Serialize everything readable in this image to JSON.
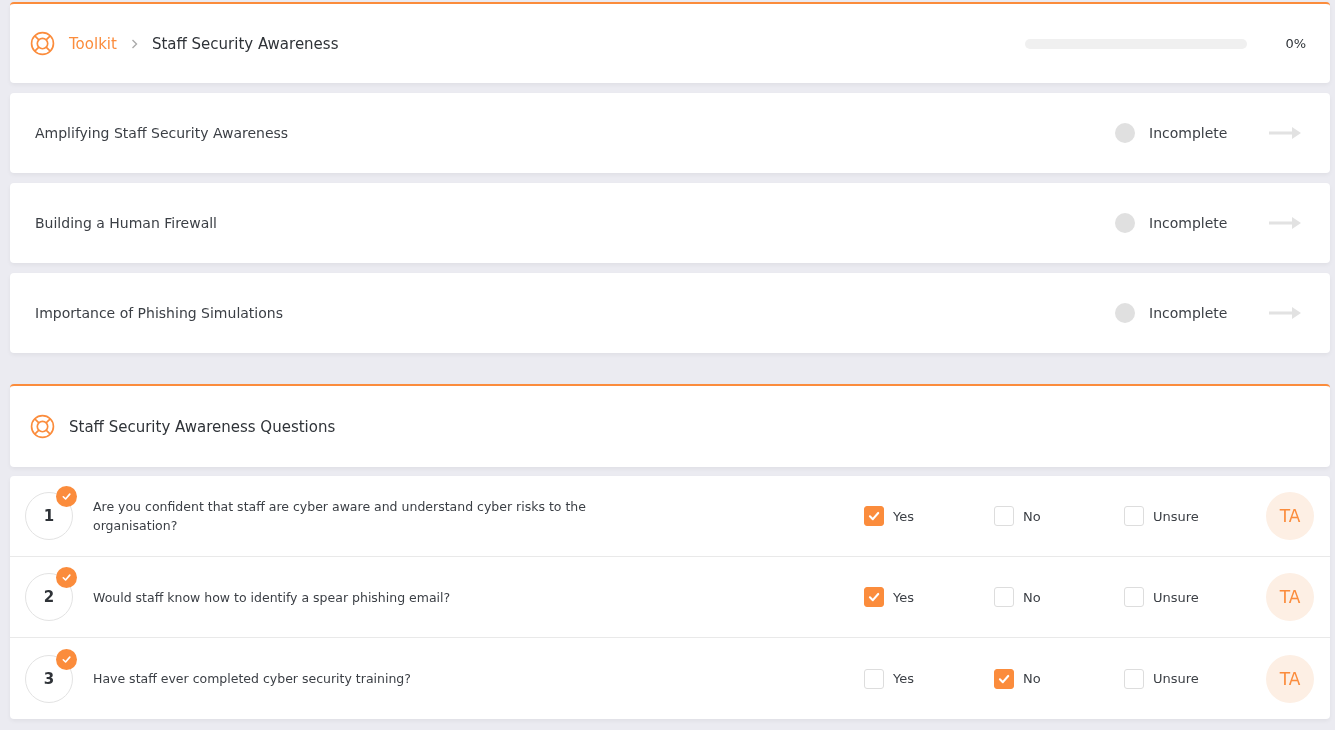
{
  "header": {
    "breadcrumb": [
      {
        "label": "Toolkit",
        "kind": "link"
      },
      {
        "label": "Staff Security Awareness",
        "kind": "current"
      }
    ],
    "progress": {
      "level": 0,
      "reading": "0%"
    }
  },
  "modules": [
    {
      "title": "Amplifying Staff Security Awareness",
      "status": "Incomplete",
      "complete": false
    },
    {
      "title": "Building a Human Firewall",
      "status": "Incomplete",
      "complete": false
    },
    {
      "title": "Importance of Phishing Simulations",
      "status": "Incomplete",
      "complete": false
    }
  ],
  "questions_panel": {
    "title": "Staff Security Awareness Questions"
  },
  "questions": [
    {
      "number": "1",
      "answered": true,
      "text": "Are you confident that staff are cyber aware and understand cyber risks to the organisation?",
      "options": [
        {
          "label": "Yes",
          "checked": true
        },
        {
          "label": "No",
          "checked": false
        },
        {
          "label": "Unsure",
          "checked": false
        }
      ],
      "avatar": "TA"
    },
    {
      "number": "2",
      "answered": true,
      "text": "Would staff know how to identify a spear phishing email?",
      "options": [
        {
          "label": "Yes",
          "checked": true
        },
        {
          "label": "No",
          "checked": false
        },
        {
          "label": "Unsure",
          "checked": false
        }
      ],
      "avatar": "TA"
    },
    {
      "number": "3",
      "answered": true,
      "text": "Have staff ever completed cyber security training?",
      "options": [
        {
          "label": "Yes",
          "checked": false
        },
        {
          "label": "No",
          "checked": true
        },
        {
          "label": "Unsure",
          "checked": false
        }
      ],
      "avatar": "TA"
    }
  ]
}
